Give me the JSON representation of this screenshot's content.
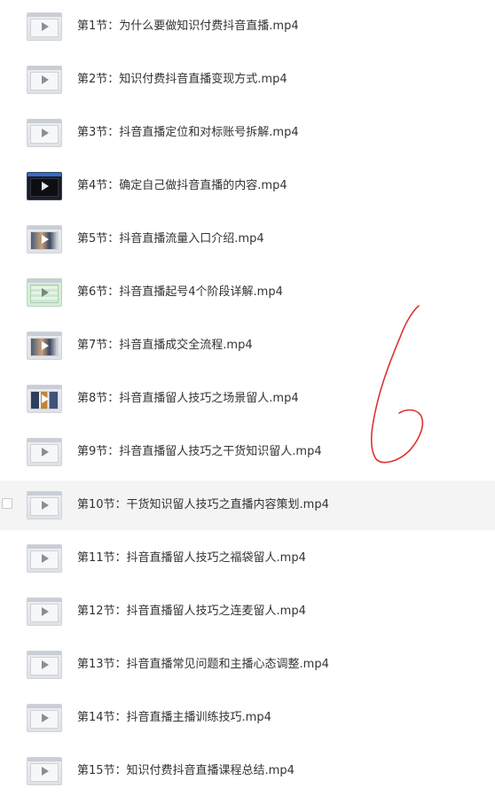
{
  "files": [
    {
      "name": "第1节：为什么要做知识付费抖音直播.mp4",
      "thumb_style": "plain"
    },
    {
      "name": "第2节：知识付费抖音直播变现方式.mp4",
      "thumb_style": "plain"
    },
    {
      "name": "第3节：抖音直播定位和对标账号拆解.mp4",
      "thumb_style": "plain"
    },
    {
      "name": "第4节：确定自己做抖音直播的内容.mp4",
      "thumb_style": "dark"
    },
    {
      "name": "第5节：抖音直播流量入口介绍.mp4",
      "thumb_style": "color"
    },
    {
      "name": "第6节：抖音直播起号4个阶段详解.mp4",
      "thumb_style": "green"
    },
    {
      "name": "第7节：抖音直播成交全流程.mp4",
      "thumb_style": "color"
    },
    {
      "name": "第8节：抖音直播留人技巧之场景留人.mp4",
      "thumb_style": "cards"
    },
    {
      "name": "第9节：抖音直播留人技巧之干货知识留人.mp4",
      "thumb_style": "plain"
    },
    {
      "name": "第10节：干货知识留人技巧之直播内容策划.mp4",
      "thumb_style": "plain"
    },
    {
      "name": "第11节：抖音直播留人技巧之福袋留人.mp4",
      "thumb_style": "plain"
    },
    {
      "name": "第12节：抖音直播留人技巧之连麦留人.mp4",
      "thumb_style": "plain"
    },
    {
      "name": "第13节：抖音直播常见问题和主播心态调整.mp4",
      "thumb_style": "plain"
    },
    {
      "name": "第14节：抖音直播主播训练技巧.mp4",
      "thumb_style": "plain"
    },
    {
      "name": "第15节：知识付费抖音直播课程总结.mp4",
      "thumb_style": "plain"
    }
  ],
  "hovered_index": 9,
  "annotation": {
    "color": "#e03030"
  }
}
